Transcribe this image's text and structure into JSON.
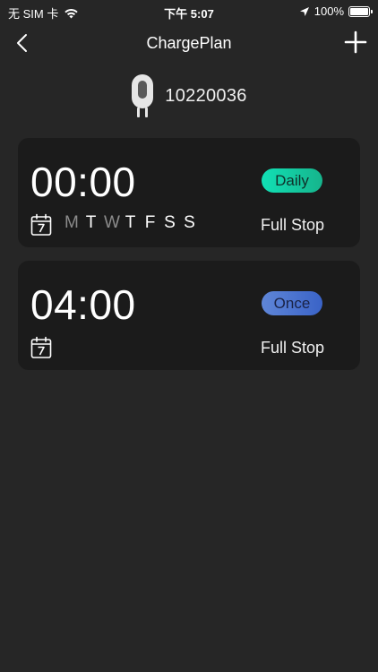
{
  "status_bar": {
    "carrier": "无 SIM 卡",
    "time": "下午 5:07",
    "battery": "100%",
    "battery_level": 1.0
  },
  "nav": {
    "title": "ChargePlan",
    "back_icon": "chevron-left-icon",
    "add_icon": "plus-icon"
  },
  "device": {
    "id": "10220036",
    "icon": "charger-plug-icon"
  },
  "plans": [
    {
      "time": "00:00",
      "repeat": "Daily",
      "mode": "Full Stop",
      "days": [
        {
          "label": "M",
          "active": false
        },
        {
          "label": "T",
          "active": true
        },
        {
          "label": "W",
          "active": false
        },
        {
          "label": "T",
          "active": true
        },
        {
          "label": "F",
          "active": true
        },
        {
          "label": "S",
          "active": true
        },
        {
          "label": "S",
          "active": true
        }
      ]
    },
    {
      "time": "04:00",
      "repeat": "Once",
      "mode": "Full Stop",
      "days": []
    }
  ],
  "colors": {
    "background": "#262626",
    "card": "#1b1b1b",
    "daily_badge": "#11d1a6",
    "once_badge": "#4d74d0",
    "inactive_day": "#8b8b8b"
  }
}
